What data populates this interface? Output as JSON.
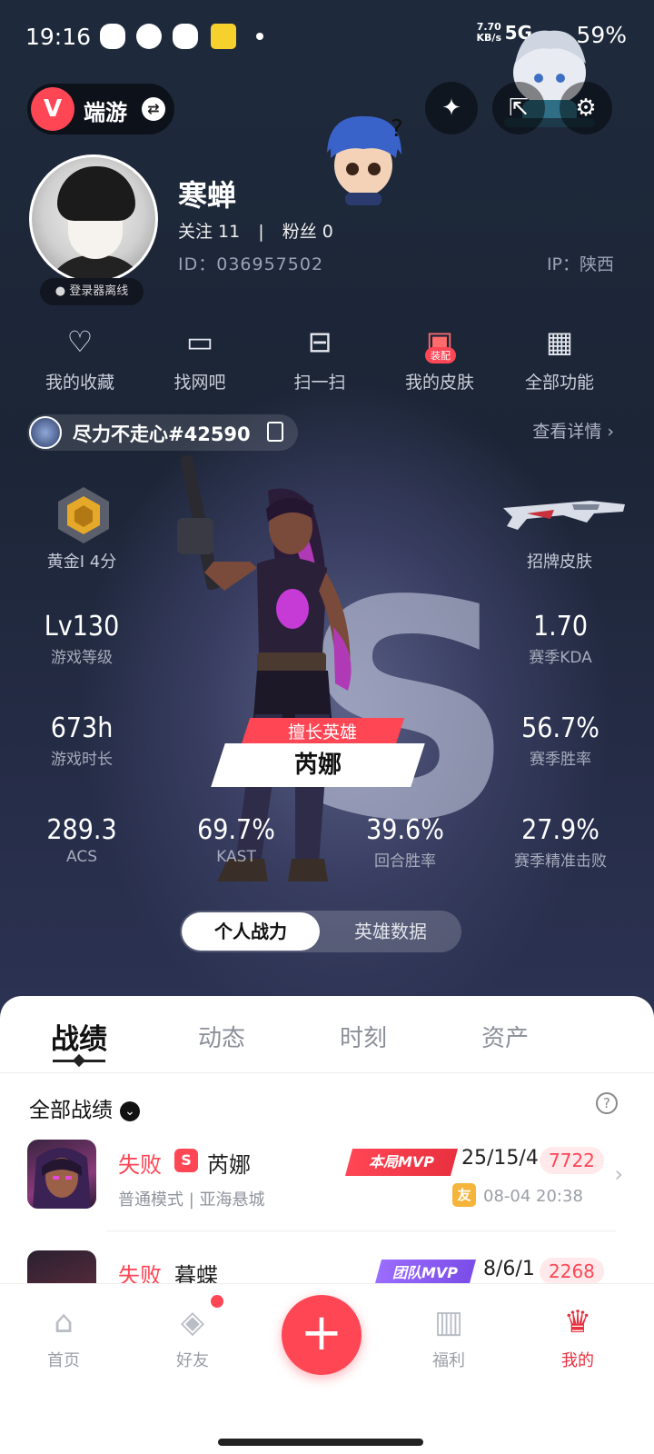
{
  "status": {
    "time": "19:16",
    "net_speed": "7.70",
    "net_unit": "KB/s",
    "signal": "5G",
    "battery": "59%"
  },
  "app": {
    "name": "端游",
    "logo": "V"
  },
  "profile": {
    "nickname": "寒蝉",
    "follow_label": "关注 11",
    "fans_label": "粉丝 0",
    "separator": "|",
    "uid": "ID：036957502",
    "ip": "IP：陕西",
    "login_status": "登录器离线"
  },
  "quick": [
    {
      "icon": "heart-icon",
      "label": "我的收藏"
    },
    {
      "icon": "monitor-icon",
      "label": "找网吧"
    },
    {
      "icon": "scan-icon",
      "label": "扫一扫"
    },
    {
      "icon": "skin-icon",
      "label": "我的皮肤",
      "tag": "装配"
    },
    {
      "icon": "grid-icon",
      "label": "全部功能"
    }
  ],
  "game_id": "尽力不走心#42590",
  "view_detail": "查看详情 ›",
  "rank": {
    "label": "黄金I 4分"
  },
  "signature_skin": {
    "label": "招牌皮肤"
  },
  "stats": {
    "level": {
      "value": "Lv130",
      "label": "游戏等级"
    },
    "kda": {
      "value": "1.70",
      "label": "赛季KDA"
    },
    "playtime": {
      "value": "673h",
      "label": "游戏时长"
    },
    "winrate": {
      "value": "56.7%",
      "label": "赛季胜率"
    },
    "acs": {
      "value": "289.3",
      "label": "ACS"
    },
    "kast": {
      "value": "69.7%",
      "label": "KAST"
    },
    "round_win": {
      "value": "39.6%",
      "label": "回合胜率"
    },
    "precise": {
      "value": "27.9%",
      "label": "赛季精准击败"
    }
  },
  "best_hero": {
    "tag": "擅长英雄",
    "name": "芮娜"
  },
  "toggle": {
    "on": "个人战力",
    "off": "英雄数据"
  },
  "tabs": [
    "战绩",
    "动态",
    "时刻",
    "资产"
  ],
  "filter_label": "全部战绩",
  "help": "?",
  "matches": [
    {
      "result": "失败",
      "mode_badge": "S",
      "hero": "芮娜",
      "mvp": "本局MVP",
      "kda": "25/15/4",
      "score": "7722",
      "sub": "普通模式 | 亚海悬城",
      "friend": "友",
      "date": "08-04 20:38"
    },
    {
      "result": "失败",
      "hero": "暮蝶",
      "mvp": "团队MVP",
      "kda": "8/6/1",
      "score": "2268"
    }
  ],
  "nav": [
    {
      "icon": "home-icon",
      "label": "首页"
    },
    {
      "icon": "friends-icon",
      "label": "好友"
    },
    {
      "icon": "gift-icon",
      "label": "福利"
    },
    {
      "icon": "profile-icon",
      "label": "我的"
    }
  ],
  "colors": {
    "accent": "#ff4655",
    "mvp_red": "#e8303f",
    "mvp_purple": "#8a5cf5"
  }
}
